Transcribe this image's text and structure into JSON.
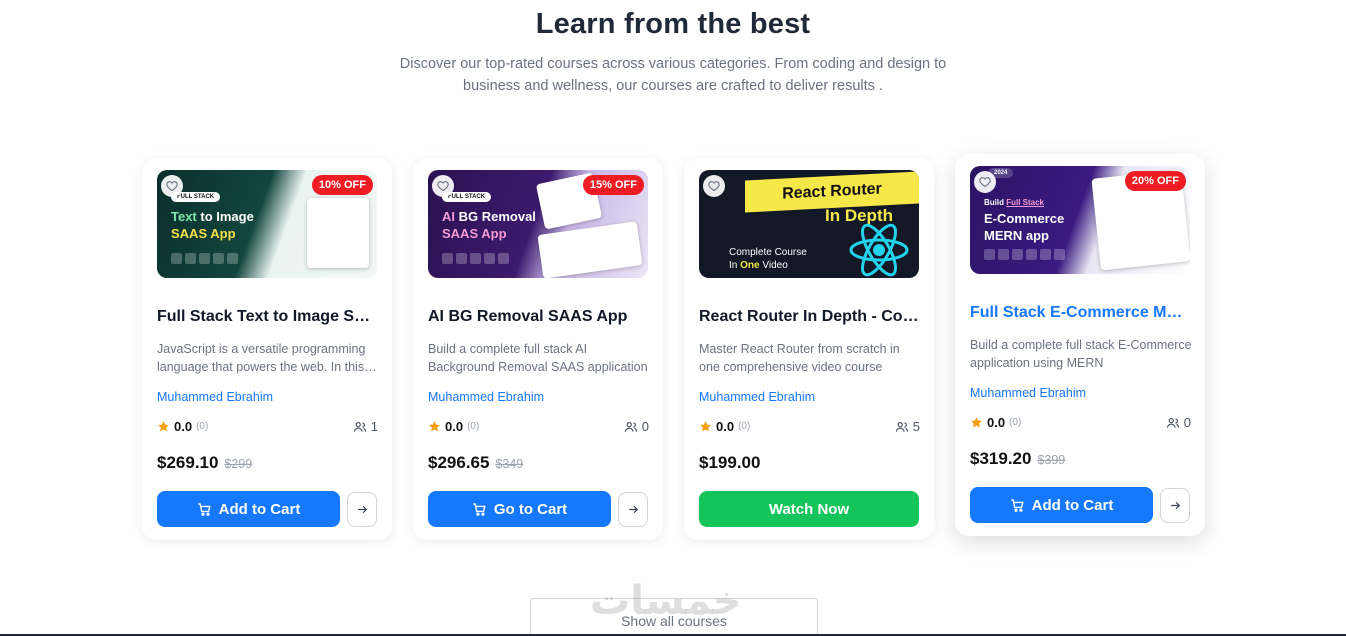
{
  "header": {
    "title": "Learn from the best",
    "subtitle": "Discover our top-rated courses across various categories. From coding and design to business and wellness, our courses are crafted to deliver results ."
  },
  "courses": [
    {
      "discount": "10% OFF",
      "thumb": {
        "badge": "FULL STACK",
        "line1a": "Text",
        "line1b": " to Image",
        "line2": "SAAS App"
      },
      "title": "Full Stack Text to Image SAAS App",
      "description": "JavaScript is a versatile programming language that powers the web. In this course",
      "author": "Muhammed Ebrahim",
      "rating": "0.0",
      "rating_count": "(0)",
      "students": "1",
      "price": "$269.10",
      "old_price": "$299",
      "button": "Add to Cart"
    },
    {
      "discount": "15% OFF",
      "thumb": {
        "badge": "FULL STACK",
        "line1a": "AI",
        "line1b": " BG Removal",
        "line2": "SAAS App"
      },
      "title": "AI BG Removal SAAS App",
      "description": "Build a complete full stack AI Background Removal SAAS application",
      "author": "Muhammed Ebrahim",
      "rating": "0.0",
      "rating_count": "(0)",
      "students": "0",
      "price": "$296.65",
      "old_price": "$349",
      "button": "Go to Cart"
    },
    {
      "thumb": {
        "banner": "React Router",
        "depth": "In Depth",
        "line1": "Complete Course",
        "line2a": "In ",
        "line2b": "One",
        "line2c": " Video"
      },
      "title": "React Router In Depth - Complete Course",
      "description": "Master React Router from scratch in one comprehensive video course",
      "author": "Muhammed Ebrahim",
      "rating": "0.0",
      "rating_count": "(0)",
      "students": "5",
      "price": "$199.00",
      "button": "Watch Now"
    },
    {
      "discount": "20% OFF",
      "thumb": {
        "badge": "2024",
        "line0a": "Build ",
        "line0b": "Full Stack",
        "line1": "E-Commerce",
        "line2": "MERN app"
      },
      "title": "Full Stack E-Commerce MERN App",
      "description": "Build a complete full stack E-Commerce application using MERN",
      "author": "Muhammed Ebrahim",
      "rating": "0.0",
      "rating_count": "(0)",
      "students": "0",
      "price": "$319.20",
      "old_price": "$399",
      "button": "Add to Cart"
    }
  ],
  "footer": {
    "show_all": "Show all courses",
    "watermark": "خمسات"
  },
  "colors": {
    "primary": "#1677ff",
    "success": "#15c55c",
    "discount": "#ef1c24",
    "star": "#f59e0b"
  }
}
